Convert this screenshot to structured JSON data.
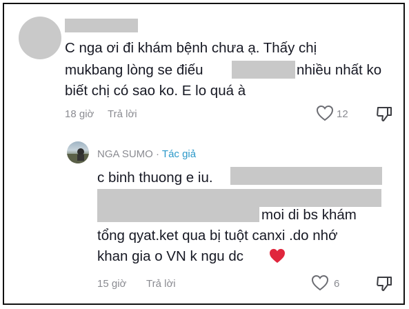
{
  "comment1": {
    "lines": [
      "C nga ơi đi khám bệnh chưa ạ. Thấy chị",
      "mukbang lòng se điếu",
      "nhiều nhất ko",
      "biết chị có sao ko. E lo quá à"
    ],
    "time": "18 giờ",
    "reply_label": "Trả lời",
    "likes": "12"
  },
  "reply": {
    "author": "NGA SUMO",
    "separator": " · ",
    "author_badge": "Tác giả",
    "lines": [
      "c binh thuong e iu.",
      "moi di bs khám",
      "tổng qyat.ket qua bị tuột canxi .do nhớ",
      "khan gia o VN k ngu dc"
    ],
    "emoji": "❤️",
    "time": "15 giờ",
    "reply_label": "Trả lời",
    "likes": "6"
  },
  "icons": {
    "like": "heart-outline-icon",
    "dislike": "thumbs-down-icon",
    "emoji": "red-heart-emoji"
  }
}
